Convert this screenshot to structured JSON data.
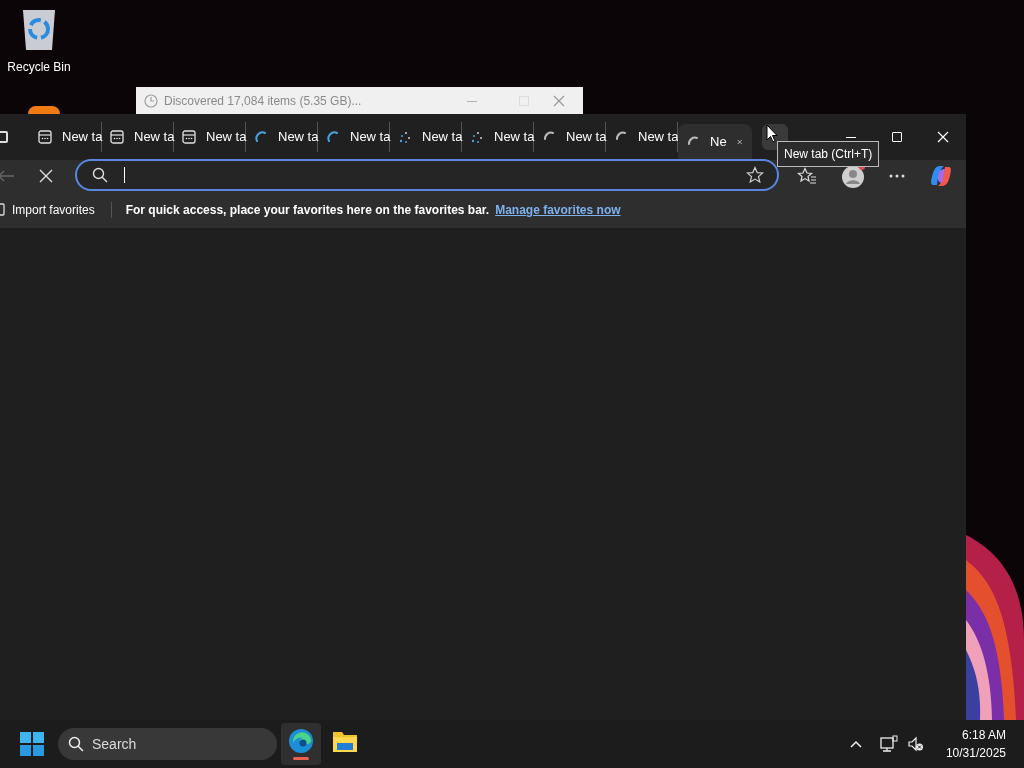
{
  "desktop": {
    "icons": [
      {
        "label": "Recycle Bin"
      }
    ]
  },
  "copy_dialog": {
    "title": "Discovered 17,084 items (5.35 GB)..."
  },
  "browser": {
    "tabs": [
      {
        "label": "New ta",
        "kind": "page",
        "selected": false
      },
      {
        "label": "New ta",
        "kind": "page",
        "selected": false
      },
      {
        "label": "New ta",
        "kind": "page",
        "selected": false
      },
      {
        "label": "New ta",
        "kind": "loading_blue",
        "selected": false
      },
      {
        "label": "New ta",
        "kind": "loading_blue",
        "selected": false
      },
      {
        "label": "New ta",
        "kind": "loading_dots",
        "selected": false
      },
      {
        "label": "New ta",
        "kind": "loading_dots",
        "selected": false
      },
      {
        "label": "New ta",
        "kind": "loading_grey",
        "selected": false
      },
      {
        "label": "New ta",
        "kind": "loading_grey",
        "selected": false
      },
      {
        "label": "Ne",
        "kind": "loading_grey",
        "selected": true
      }
    ],
    "tooltip": "New tab (Ctrl+T)",
    "favorites_bar": {
      "import": "Import favorites",
      "message": "For quick access, place your favorites here on the favorites bar.",
      "link": "Manage favorites now"
    }
  },
  "taskbar": {
    "search": "Search",
    "apps": [
      {
        "kind": "edge",
        "selected": true
      },
      {
        "kind": "explorer",
        "selected": false
      }
    ],
    "time": "6:18 AM",
    "date": "10/31/2025"
  }
}
